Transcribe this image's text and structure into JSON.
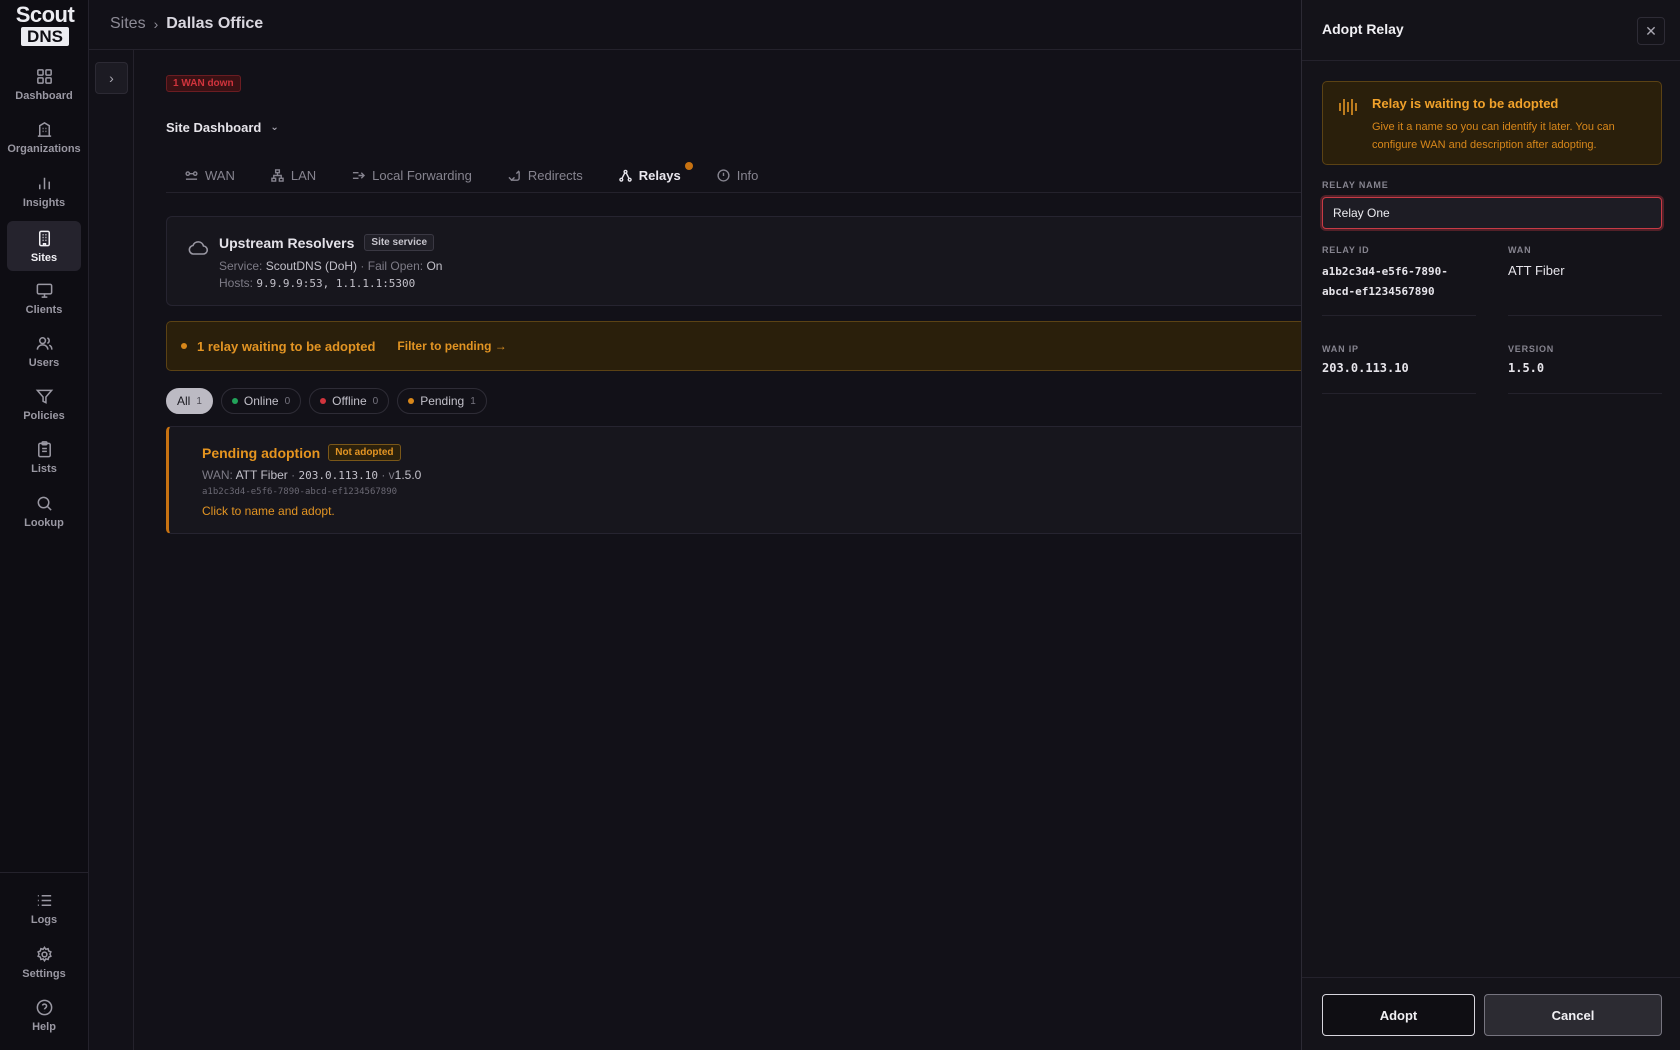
{
  "brand": {
    "line1": "Scout",
    "line2": "DNS"
  },
  "sidebar": {
    "items": [
      {
        "label": "Dashboard",
        "icon": "grid-icon"
      },
      {
        "label": "Organizations",
        "icon": "building-icon"
      },
      {
        "label": "Insights",
        "icon": "bar-chart-icon"
      },
      {
        "label": "Sites",
        "icon": "site-building-icon",
        "active": true
      },
      {
        "label": "Clients",
        "icon": "monitor-icon"
      },
      {
        "label": "Users",
        "icon": "users-icon"
      },
      {
        "label": "Policies",
        "icon": "filter-icon"
      },
      {
        "label": "Lists",
        "icon": "clipboard-icon"
      },
      {
        "label": "Lookup",
        "icon": "search-icon"
      }
    ],
    "bottom_items": [
      {
        "label": "Logs",
        "icon": "list-icon"
      },
      {
        "label": "Settings",
        "icon": "gear-icon"
      },
      {
        "label": "Help",
        "icon": "help-circle-icon"
      }
    ]
  },
  "breadcrumb": {
    "parent": "Sites",
    "separator": "›",
    "current": "Dallas Office"
  },
  "main": {
    "wan_badge": "1 WAN down",
    "dashboard_select": "Site Dashboard",
    "tabs": [
      {
        "label": "WAN",
        "icon": "wan-icon"
      },
      {
        "label": "LAN",
        "icon": "network-icon"
      },
      {
        "label": "Local Forwarding",
        "icon": "forward-icon"
      },
      {
        "label": "Redirects",
        "icon": "redirect-icon"
      },
      {
        "label": "Relays",
        "icon": "relay-icon",
        "active": true,
        "has_indicator": true
      },
      {
        "label": "Info",
        "icon": "info-icon"
      }
    ],
    "upstream": {
      "title": "Upstream Resolvers",
      "badge": "Site service",
      "service_label": "Service:",
      "service_value": "ScoutDNS (DoH)",
      "fail_open_label": "· Fail Open:",
      "fail_open_value": "On",
      "hosts_label": "Hosts:",
      "hosts_value": "9.9.9.9:53, 1.1.1.1:5300"
    },
    "pending_banner": {
      "text": "1 relay waiting to be adopted",
      "link": "Filter to pending →"
    },
    "filters": [
      {
        "label": "All",
        "count": "1",
        "active": true
      },
      {
        "label": "Online",
        "count": "0",
        "dot_color": "#22a35a"
      },
      {
        "label": "Offline",
        "count": "0",
        "dot_color": "#d1343d"
      },
      {
        "label": "Pending",
        "count": "1",
        "dot_color": "#d8871a"
      }
    ],
    "relay_card": {
      "title": "Pending adoption",
      "badge": "Not adopted",
      "wan_label": "WAN:",
      "wan_value": "ATT Fiber",
      "ip_sep": "·",
      "ip": "203.0.113.10",
      "ver_sep": "· v",
      "version": "1.5.0",
      "relay_id": "a1b2c3d4-e5f6-7890-abcd-ef1234567890",
      "hint": "Click to name and adopt."
    }
  },
  "panel": {
    "title": "Adopt Relay",
    "close": "✕",
    "notice_title": "Relay is waiting to be adopted",
    "notice_text": "Give it a name so you can identify it later. You can configure WAN and description after adopting.",
    "relay_name_label": "RELAY NAME",
    "relay_name_value": "Relay One",
    "relay_id_label": "RELAY ID",
    "relay_id_line1": "a1b2c3d4-e5f6-7890-",
    "relay_id_line2": "abcd-ef1234567890",
    "wan_label": "WAN",
    "wan_value": "ATT Fiber",
    "wan_ip_label": "WAN IP",
    "wan_ip_value": "203.0.113.10",
    "version_label": "VERSION",
    "version_value": "1.5.0",
    "adopt_button": "Adopt",
    "cancel_button": "Cancel"
  },
  "colors": {
    "accent_warning": "#e29423",
    "error": "#d1343d",
    "background": "#121118"
  }
}
